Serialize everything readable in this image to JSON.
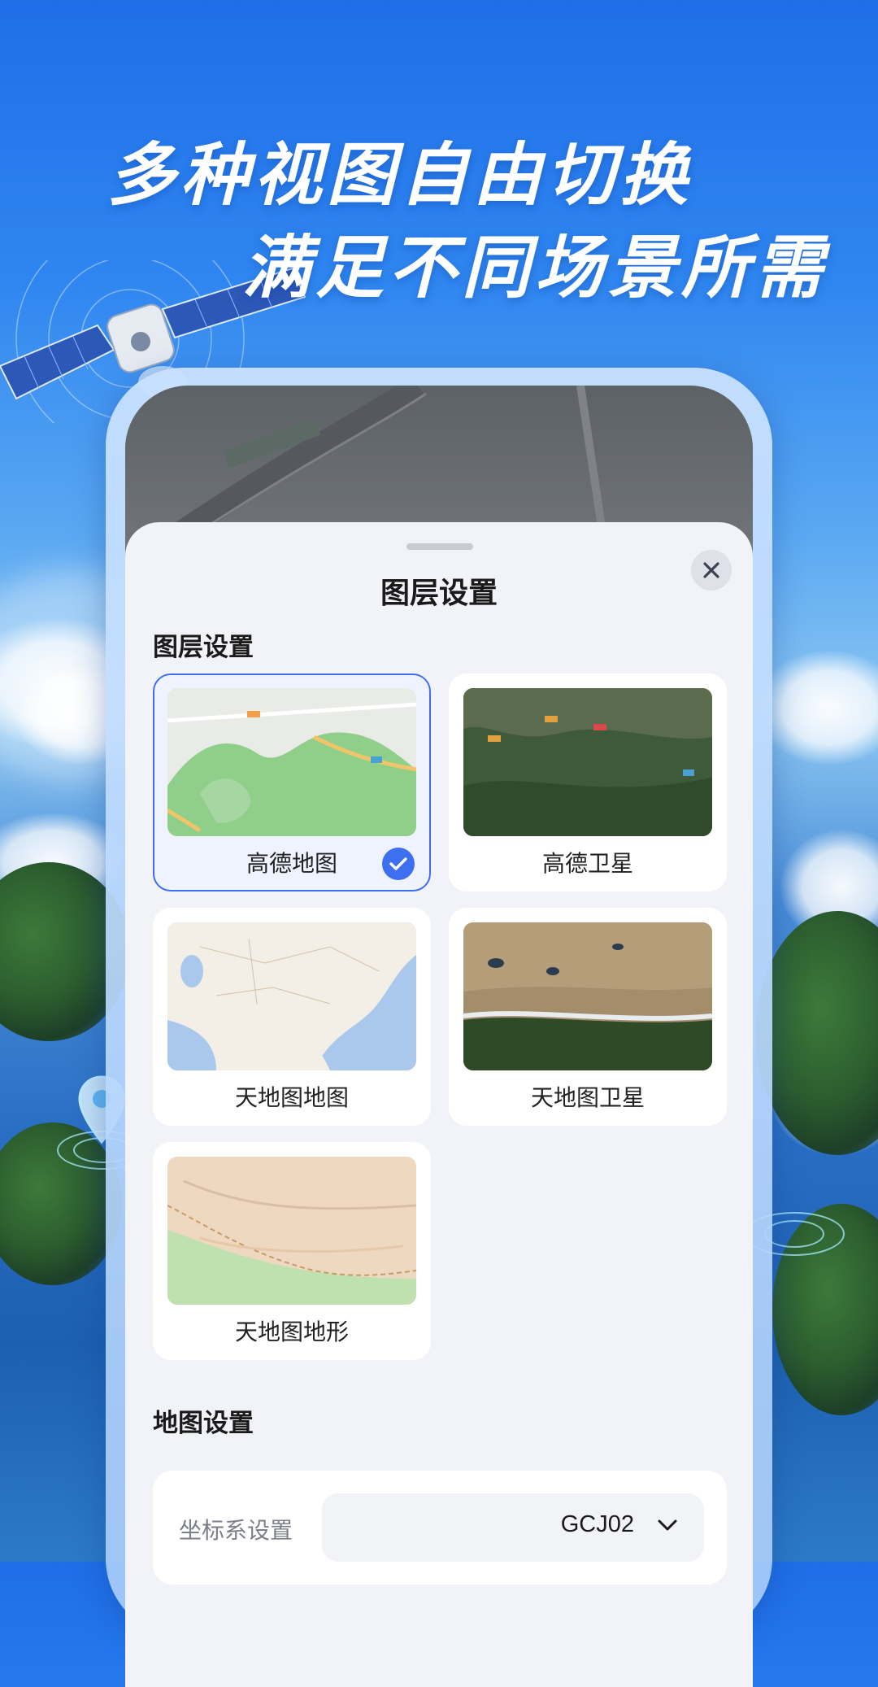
{
  "headline": {
    "line1": "多种视图自由切换",
    "line2": "满足不同场景所需"
  },
  "sheet": {
    "title": "图层设置",
    "close_icon": "close-icon"
  },
  "layers_section": {
    "label": "图层设置",
    "options": [
      {
        "label": "高德地图",
        "selected": true
      },
      {
        "label": "高德卫星",
        "selected": false
      },
      {
        "label": "天地图地图",
        "selected": false
      },
      {
        "label": "天地图卫星",
        "selected": false
      },
      {
        "label": "天地图地形",
        "selected": false
      }
    ]
  },
  "map_section": {
    "label": "地图设置",
    "coordinate": {
      "label": "坐标系设置",
      "value": "GCJ02",
      "icon": "chevron-down-icon"
    }
  },
  "colors": {
    "accent": "#3d6ff0",
    "sheet_bg": "#f2f3f8"
  }
}
